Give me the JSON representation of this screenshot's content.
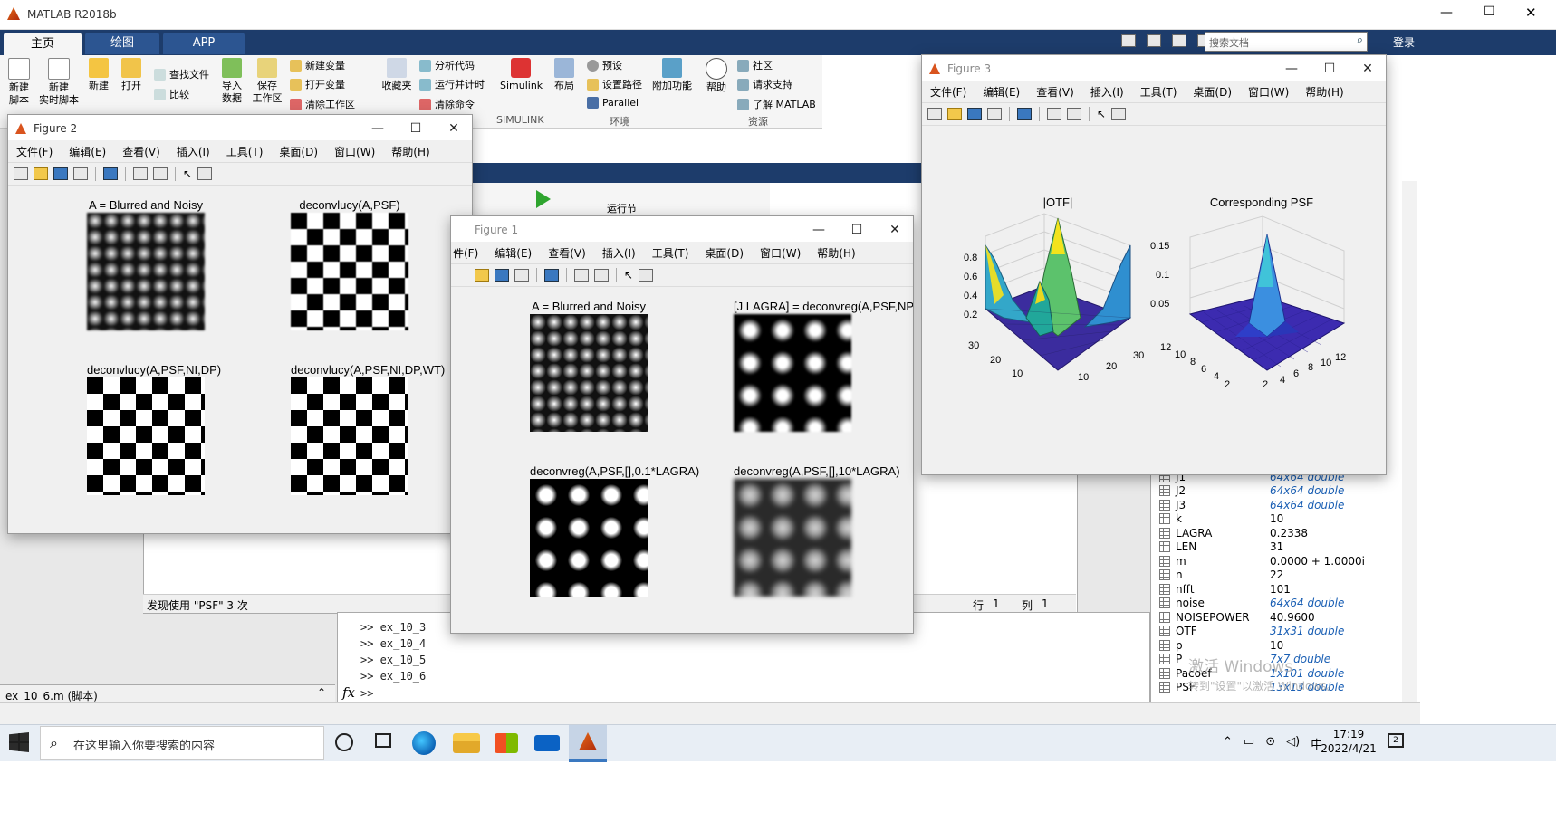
{
  "app": {
    "title": "MATLAB R2018b",
    "login": "登录",
    "search_placeholder": "搜索文档"
  },
  "ribbon": {
    "tabs": [
      "主页",
      "绘图",
      "APP"
    ],
    "buttons": {
      "new_script": "新建\n脚本",
      "new_live": "新建\n实时脚本",
      "new": "新建",
      "open": "打开",
      "find_files": "查找文件",
      "compare": "比较",
      "import": "导入\n数据",
      "save_ws": "保存\n工作区",
      "new_var": "新建变量",
      "open_var": "打开变量",
      "clear_ws": "清除工作区",
      "favorites": "收藏夹",
      "analyze": "分析代码",
      "run_time": "运行并计时",
      "clear_cmd": "清除命令",
      "simulink": "Simulink",
      "layout": "布局",
      "prefs": "预设",
      "set_path": "设置路径",
      "parallel": "Parallel",
      "addons": "附加功能",
      "help": "帮助",
      "community": "社区",
      "support": "请求支持",
      "learn": "了解 MATLAB"
    },
    "groups": {
      "simulink": "SIMULINK",
      "env": "环境",
      "resources": "资源"
    }
  },
  "menus": [
    "文件(F)",
    "编辑(E)",
    "查看(V)",
    "插入(I)",
    "工具(T)",
    "桌面(D)",
    "窗口(W)",
    "帮助(H)"
  ],
  "menus_fig1": [
    "件(F)",
    "编辑(E)",
    "查看(V)",
    "插入(I)",
    "工具(T)",
    "桌面(D)",
    "窗口(W)",
    "帮助(H)"
  ],
  "figure2": {
    "title": "Figure 2",
    "plots": [
      "A = Blurred and Noisy",
      "deconvlucy(A,PSF)",
      "deconvlucy(A,PSF,NI,DP)",
      "deconvlucy(A,PSF,NI,DP,WT)"
    ]
  },
  "figure1": {
    "title": "Figure 1",
    "plots": [
      "A = Blurred and Noisy",
      "[J LAGRA] = deconvreg(A,PSF,NP)",
      "deconvreg(A,PSF,[],0.1*LAGRA)",
      "deconvreg(A,PSF,[],10*LAGRA)"
    ]
  },
  "figure3": {
    "title": "Figure 3",
    "otf": {
      "title": "|OTF|",
      "z_ticks": [
        "0.8",
        "0.6",
        "0.4",
        "0.2"
      ],
      "x_ticks": [
        "30",
        "20",
        "10"
      ],
      "y_ticks": [
        "10",
        "20",
        "30"
      ]
    },
    "psf": {
      "title": "Corresponding PSF",
      "z_ticks": [
        "0.15",
        "0.1",
        "0.05"
      ],
      "x_ticks": [
        "12",
        "10",
        "8",
        "6",
        "4",
        "2"
      ],
      "y_ticks": [
        "2",
        "4",
        "6",
        "8",
        "10",
        "12"
      ]
    }
  },
  "editor": {
    "run_section": "运行节",
    "status_find": "发现使用 \"PSF\" 3 次",
    "row_label": "行",
    "row": "1",
    "col_label": "列",
    "col": "1"
  },
  "command_history": [
    ">> ex_10_3",
    ">> ex_10_4",
    ">> ex_10_5",
    ">> ex_10_6"
  ],
  "command_prompt": ">>",
  "current_file": "ex_10_6.m  (脚本)",
  "workspace": [
    {
      "name": "J1",
      "value": "64x64 double",
      "italic": true
    },
    {
      "name": "J2",
      "value": "64x64 double",
      "italic": true
    },
    {
      "name": "J3",
      "value": "64x64 double",
      "italic": true
    },
    {
      "name": "k",
      "value": "10",
      "italic": false
    },
    {
      "name": "LAGRA",
      "value": "0.2338",
      "italic": false
    },
    {
      "name": "LEN",
      "value": "31",
      "italic": false
    },
    {
      "name": "m",
      "value": "0.0000 + 1.0000i",
      "italic": false
    },
    {
      "name": "n",
      "value": "22",
      "italic": false
    },
    {
      "name": "nfft",
      "value": "101",
      "italic": false
    },
    {
      "name": "noise",
      "value": "64x64 double",
      "italic": true
    },
    {
      "name": "NOISEPOWER",
      "value": "40.9600",
      "italic": false
    },
    {
      "name": "OTF",
      "value": "31x31 double",
      "italic": true
    },
    {
      "name": "p",
      "value": "10",
      "italic": false
    },
    {
      "name": "P",
      "value": "7x7 double",
      "italic": true
    },
    {
      "name": "Pacoef",
      "value": "1x101 double",
      "italic": true
    },
    {
      "name": "PSF",
      "value": "13x13 double",
      "italic": true
    }
  ],
  "watermark": {
    "line1": "激活 Windows",
    "line2": "转到\"设置\"以激活 Windows。"
  },
  "taskbar": {
    "search": "在这里输入你要搜索的内容",
    "time": "17:19",
    "date": "2022/4/21",
    "ime": "中",
    "notif": "2"
  }
}
